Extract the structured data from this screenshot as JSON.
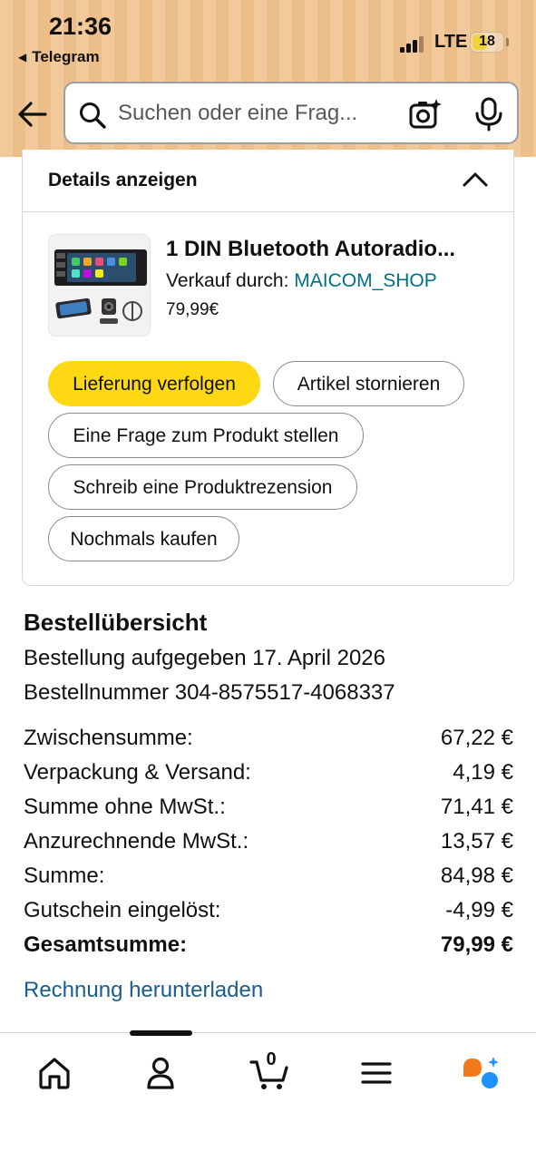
{
  "status_bar": {
    "time": "21:36",
    "back_app": "Telegram",
    "network": "LTE",
    "battery": "18"
  },
  "search": {
    "placeholder": "Suchen oder eine Frag..."
  },
  "details": {
    "label": "Details anzeigen"
  },
  "product": {
    "title": "1 DIN Bluetooth Autoradio...",
    "seller_prefix": "Verkauf durch: ",
    "seller_name": "MAICOM_SHOP",
    "price": "79,99€"
  },
  "actions": {
    "track": "Lieferung verfolgen",
    "cancel": "Artikel stornieren",
    "question": "Eine Frage zum Produkt stellen",
    "review": "Schreib eine Produktrezension",
    "buy_again": "Nochmals kaufen"
  },
  "summary": {
    "title": "Bestellübersicht",
    "order_date": "Bestellung aufgegeben 17. April 2026",
    "order_number": "Bestellnummer 304-8575517-4068337",
    "rows": [
      {
        "label": "Zwischensumme:",
        "value": "67,22 €"
      },
      {
        "label": "Verpackung & Versand:",
        "value": "4,19 €"
      },
      {
        "label": "Summe ohne MwSt.:",
        "value": "71,41 €"
      },
      {
        "label": "Anzurechnende MwSt.:",
        "value": "13,57 €"
      },
      {
        "label": "Summe:",
        "value": "84,98 €"
      },
      {
        "label": "Gutschein eingelöst:",
        "value": "-4,99 €"
      },
      {
        "label": "Gesamtsumme:",
        "value": "79,99 €"
      }
    ],
    "invoice_link": "Rechnung herunterladen"
  },
  "bottom_nav": {
    "cart_count": "0",
    "items": [
      "home-icon",
      "account-icon",
      "cart-icon",
      "menu-icon",
      "rufus-icon"
    ]
  },
  "colors": {
    "header_bg": "#f0c38f",
    "primary_button": "#ffd814",
    "link": "#007185",
    "invoice_link": "#1a5d8e"
  }
}
